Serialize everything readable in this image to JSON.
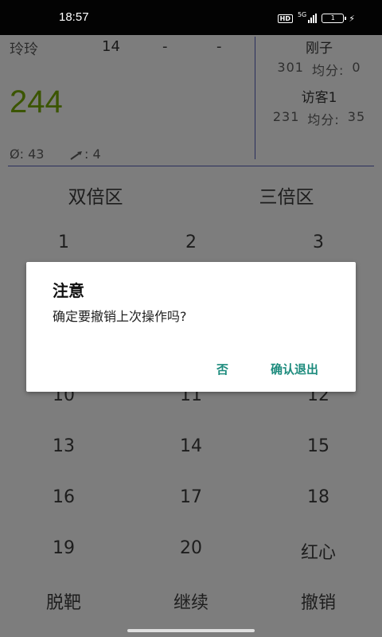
{
  "status_bar": {
    "time": "18:57",
    "hd_label": "HD",
    "network_label": "5G",
    "battery_level": "1"
  },
  "scoreboard": {
    "current_player": {
      "name": "玲玲",
      "rounds": [
        "14",
        "-",
        "-"
      ],
      "score": "244",
      "avg_stat": "Ø: 43",
      "darts_stat": ": 4"
    },
    "others": [
      {
        "name": "刚子",
        "score": "301",
        "avg_label": "均分:",
        "avg": "0"
      },
      {
        "name": "访客1",
        "score": "231",
        "avg_label": "均分:",
        "avg": "35"
      }
    ]
  },
  "pad": {
    "zones": [
      "双倍区",
      "三倍区"
    ],
    "numbers": [
      [
        "1",
        "2",
        "3"
      ],
      [
        "10",
        "11",
        "12"
      ],
      [
        "13",
        "14",
        "15"
      ],
      [
        "16",
        "17",
        "18"
      ],
      [
        "19",
        "20",
        "红心"
      ]
    ],
    "actions": [
      "脱靶",
      "继续",
      "撤销"
    ]
  },
  "dialog": {
    "title": "注意",
    "message": "确定要撤销上次操作吗?",
    "negative_label": "否",
    "positive_label": "确认退出"
  },
  "colors": {
    "score_green": "#3b5500",
    "dialog_button": "#1e8c7e",
    "divider": "#2a2f5c"
  }
}
